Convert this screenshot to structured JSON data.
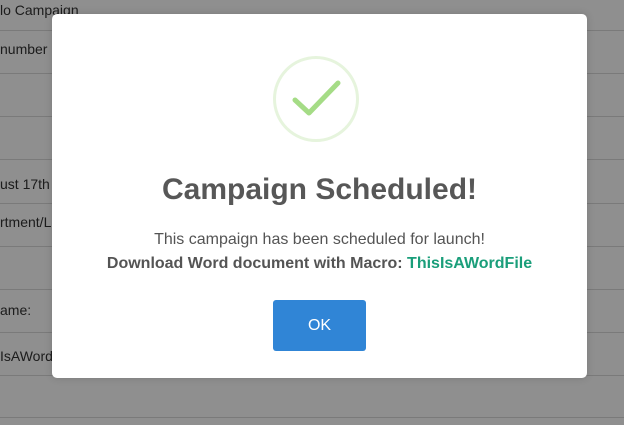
{
  "background_form": {
    "rows": [
      {
        "label": "lo Campaign"
      },
      {
        "label": "number"
      },
      {
        "label": ""
      },
      {
        "label": ""
      },
      {
        "label": "ust 17th"
      },
      {
        "label": "rtment/L"
      },
      {
        "label": ""
      },
      {
        "label": "ame:"
      },
      {
        "label": "IsAWord"
      },
      {
        "label": ""
      }
    ]
  },
  "modal": {
    "icon": "checkmark-icon",
    "title": "Campaign Scheduled!",
    "message": "This campaign has been scheduled for launch!",
    "download_prefix": "Download Word document with Macro:",
    "download_file": "ThisIsAWordFile",
    "ok_label": "OK"
  },
  "colors": {
    "accent_button": "#3085d6",
    "success_check": "#a5dc86",
    "file_link": "#1a9e7a",
    "title_text": "#575757"
  }
}
